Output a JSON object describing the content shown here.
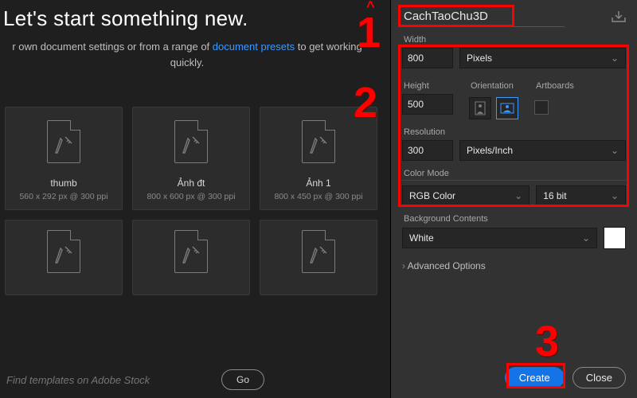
{
  "headline": "Let's start something new.",
  "subline_a": "r own document settings or from a range of ",
  "subline_link": "document presets",
  "subline_b": " to get working quickly.",
  "presets": [
    {
      "name": "thumb",
      "meta": "560 x 292 px @ 300 ppi"
    },
    {
      "name": "Ảnh đt",
      "meta": "800 x 600 px @ 300 ppi"
    },
    {
      "name": "Ảnh 1",
      "meta": "800 x 450 px @ 300 ppi"
    }
  ],
  "search_placeholder": "Find templates on Adobe Stock",
  "go_label": "Go",
  "preset_name": "CachTaoChu3D",
  "labels": {
    "width": "Width",
    "height": "Height",
    "orientation": "Orientation",
    "artboards": "Artboards",
    "resolution": "Resolution",
    "color_mode": "Color Mode",
    "bg": "Background Contents",
    "adv": "Advanced Options"
  },
  "values": {
    "width": "800",
    "height": "500",
    "units": "Pixels",
    "resolution": "300",
    "res_units": "Pixels/Inch",
    "color_mode": "RGB Color",
    "bit_depth": "16 bit",
    "bg": "White"
  },
  "buttons": {
    "create": "Create",
    "close": "Close"
  },
  "annotations": {
    "a1": "1",
    "a2": "2",
    "a3": "3"
  }
}
